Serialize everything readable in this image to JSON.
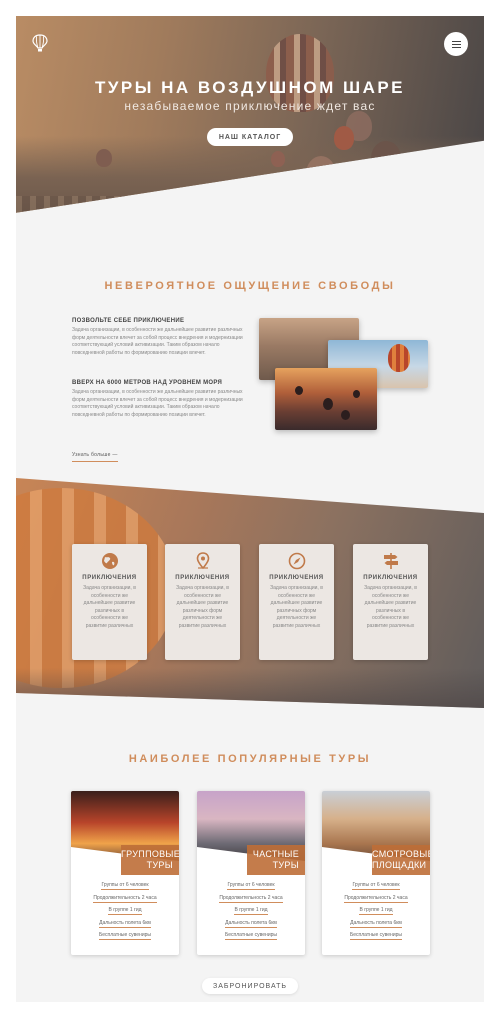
{
  "hero": {
    "title": "ТУРЫ НА ВОЗДУШНОМ ШАРЕ",
    "subtitle": "незабываемое приключение ждет вас",
    "catalog_button": "НАШ КАТАЛОГ",
    "logo_icon": "hot-air-balloon-icon",
    "menu_icon": "hamburger-menu-icon"
  },
  "freedom": {
    "title": "НЕВЕРОЯТНОЕ ОЩУЩЕНИЕ СВОБОДЫ",
    "blocks": [
      {
        "heading": "ПОЗВОЛЬТЕ СЕБЕ ПРИКЛЮЧЕНИЕ",
        "text": "Задача организации, в особенности же дальнейшее развитие различных форм деятельности влечет за собой процесс внедрения и модернизации соответствующий условий активизации. Таким образом начало повседневной работы по формированию позиции влечет."
      },
      {
        "heading": "ВВЕРХ НА 6000 МЕТРОВ НАД УРОВНЕМ МОРЯ",
        "text": "Задача организации, в особенности же дальнейшее развитие различных форм деятельности влечет за собой процесс внедрения и модернизации соответствующий условий активизации. Таким образом начало повседневной работы по формированию позиции влечет."
      }
    ],
    "more_link": "Узнать больше —"
  },
  "features": {
    "items": [
      {
        "icon": "globe-icon",
        "title": "ПРИКЛЮЧЕНИЯ",
        "text": "Задача организации, в особенности же дальнейшее развитие различных в особенности же развитие различных"
      },
      {
        "icon": "map-pin-icon",
        "title": "ПРИКЛЮЧЕНИЯ",
        "text": "Задача организации, в особенности же дальнейшее развитие различных форм деятельности же развитие различных"
      },
      {
        "icon": "compass-icon",
        "title": "ПРИКЛЮЧЕНИЯ",
        "text": "Задача организации, в особенности же дальнейшее развитие различных форм деятельности же развитие различных"
      },
      {
        "icon": "signpost-icon",
        "title": "ПРИКЛЮЧЕНИЯ",
        "text": "Задача организации, в особенности же дальнейшее развитие различных в особенности же развитие различных"
      }
    ]
  },
  "tours": {
    "title": "НАИБОЛЕЕ ПОПУЛЯРНЫЕ ТУРЫ",
    "cards": [
      {
        "tag_line1": "ГРУППОВЫЕ",
        "tag_line2": "ТУРЫ",
        "details": [
          "Группы от 6 человек",
          "Продолжительность 2 часа",
          "В группе 1 гид",
          "Дальность полета 6км",
          "Бесплатные сувениры"
        ]
      },
      {
        "tag_line1": "ЧАСТНЫЕ",
        "tag_line2": "ТУРЫ",
        "details": [
          "Группы от 6 человек",
          "Продолжительность 2 часа",
          "В группе 1 гид",
          "Дальность полета 6км",
          "Бесплатные сувениры"
        ]
      },
      {
        "tag_line1": "СМОТРОВЫЕ",
        "tag_line2": "ПЛОЩАДКИ",
        "details": [
          "Группы от 6 человек",
          "Продолжительность 2 часа",
          "В группе 1 гид",
          "Дальность полета 6км",
          "Бесплатные сувениры"
        ]
      }
    ],
    "book_button": "ЗАБРОНИРОВАТЬ"
  },
  "colors": {
    "accent": "#d08d5c",
    "tag": "#be6e37",
    "background": "#f4f4f4"
  }
}
